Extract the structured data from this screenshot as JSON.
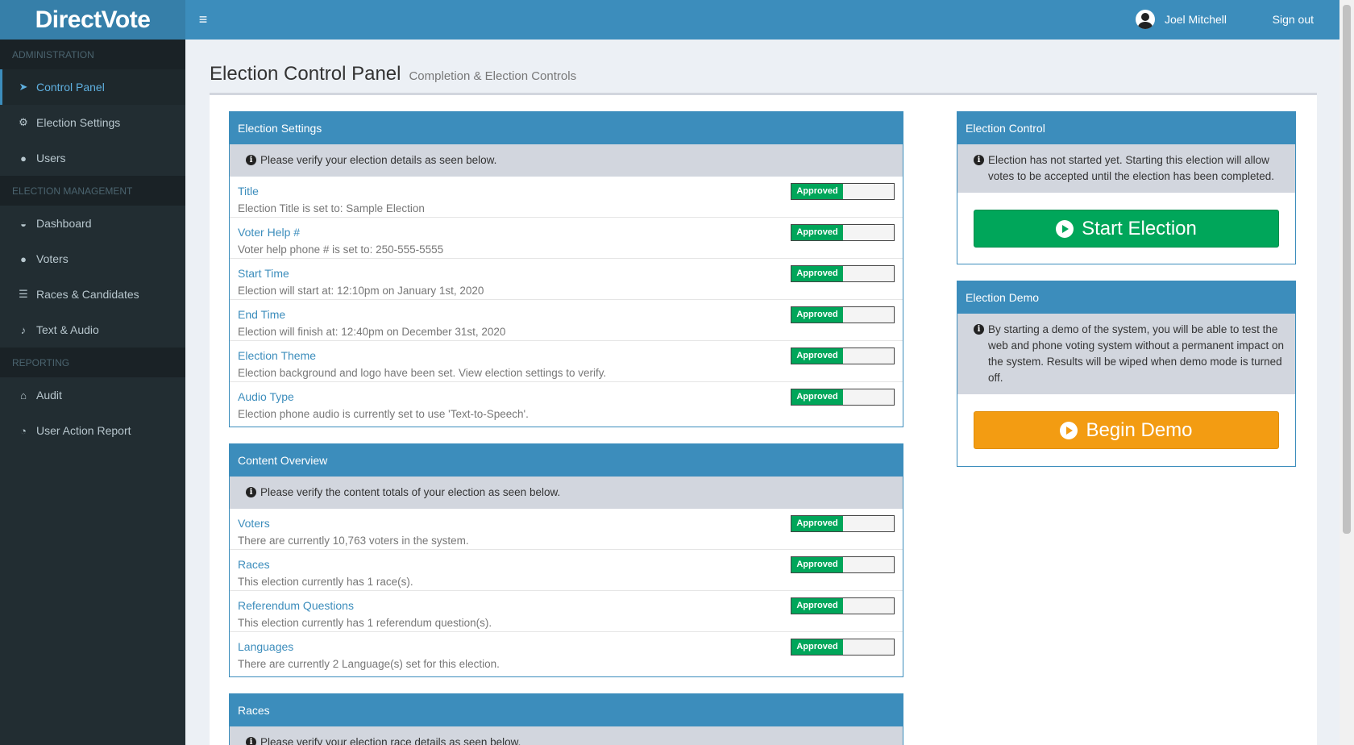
{
  "app": {
    "logo": "DirectVote"
  },
  "header": {
    "user_name": "Joel Mitchell",
    "signout_label": "Sign out"
  },
  "sidebar": {
    "sections": [
      {
        "header": "ADMINISTRATION",
        "items": [
          {
            "label": "Control Panel",
            "icon": "rocket-icon",
            "active": true
          },
          {
            "label": "Election Settings",
            "icon": "cogs-icon"
          },
          {
            "label": "Users",
            "icon": "users-icon"
          }
        ]
      },
      {
        "header": "ELECTION MANAGEMENT",
        "items": [
          {
            "label": "Dashboard",
            "icon": "dashboard-icon"
          },
          {
            "label": "Voters",
            "icon": "user-icon"
          },
          {
            "label": "Races & Candidates",
            "icon": "sliders-icon"
          },
          {
            "label": "Text & Audio",
            "icon": "microphone-icon"
          }
        ]
      },
      {
        "header": "REPORTING",
        "items": [
          {
            "label": "Audit",
            "icon": "bank-icon"
          },
          {
            "label": "User Action Report",
            "icon": "pie-chart-icon"
          }
        ]
      }
    ]
  },
  "page": {
    "title": "Election Control Panel",
    "subtitle": "Completion & Election Controls"
  },
  "election_settings": {
    "heading": "Election Settings",
    "info": "Please verify your election details as seen below.",
    "rows": [
      {
        "title": "Title",
        "desc": "Election Title is set to: Sample Election",
        "status": "Approved"
      },
      {
        "title": "Voter Help #",
        "desc": "Voter help phone # is set to: 250-555-5555",
        "status": "Approved"
      },
      {
        "title": "Start Time",
        "desc": "Election will start at: 12:10pm on January 1st, 2020",
        "status": "Approved"
      },
      {
        "title": "End Time",
        "desc": "Election will finish at: 12:40pm on December 31st, 2020",
        "status": "Approved"
      },
      {
        "title": "Election Theme",
        "desc": "Election background and logo have been set. View election settings to verify.",
        "status": "Approved"
      },
      {
        "title": "Audio Type",
        "desc": "Election phone audio is currently set to use 'Text-to-Speech'.",
        "status": "Approved"
      }
    ]
  },
  "content_overview": {
    "heading": "Content Overview",
    "info": "Please verify the content totals of your election as seen below.",
    "rows": [
      {
        "title": "Voters",
        "desc": "There are currently 10,763 voters in the system.",
        "status": "Approved"
      },
      {
        "title": "Races",
        "desc": "This election currently has 1 race(s).",
        "status": "Approved"
      },
      {
        "title": "Referendum Questions",
        "desc": "This election currently has 1 referendum question(s).",
        "status": "Approved"
      },
      {
        "title": "Languages",
        "desc": "There are currently 2 Language(s) set for this election.",
        "status": "Approved"
      }
    ]
  },
  "races": {
    "heading": "Races",
    "info": "Please verify your election race details as seen below."
  },
  "election_control": {
    "heading": "Election Control",
    "info": "Election has not started yet. Starting this election will allow votes to be accepted until the election has been completed.",
    "button": "Start Election"
  },
  "election_demo": {
    "heading": "Election Demo",
    "info": "By starting a demo of the system, you will be able to test the web and phone voting system without a permanent impact on the system. Results will be wiped when demo mode is turned off.",
    "button": "Begin Demo"
  },
  "colors": {
    "brand": "#3c8dbc",
    "approved": "#00a65a",
    "demo": "#f39c12",
    "sidebar": "#222d32"
  }
}
